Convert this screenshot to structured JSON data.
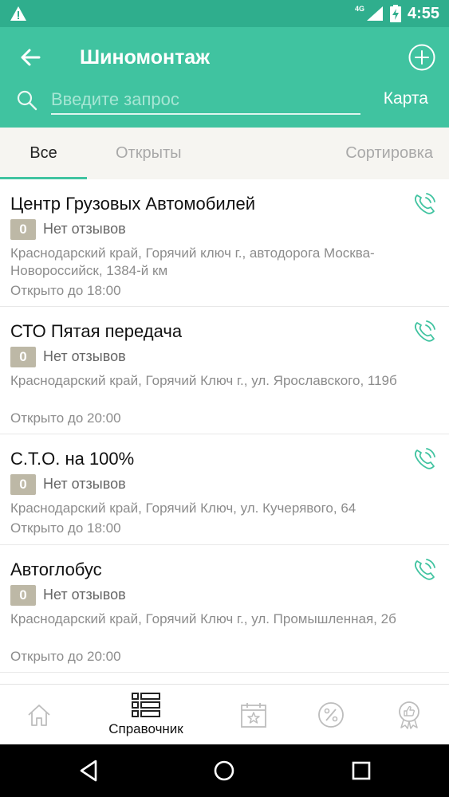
{
  "status_bar": {
    "network": "4G",
    "time": "4:55"
  },
  "app_bar": {
    "title": "Шиномонтаж",
    "search_placeholder": "Введите запрос",
    "map_label": "Карта"
  },
  "tabs": {
    "all": "Все",
    "open": "Открыты",
    "sort": "Сортировка"
  },
  "items": [
    {
      "name": "Центр Грузовых Автомобилей",
      "rating": "0",
      "reviews": "Нет отзывов",
      "address": "Краснодарский край, Горячий ключ г., автодорога Москва-Новороссийск, 1384-й км",
      "hours": "Открыто до 18:00"
    },
    {
      "name": "СТО Пятая передача",
      "rating": "0",
      "reviews": "Нет отзывов",
      "address": "Краснодарский край, Горячий Ключ г., ул. Ярославского, 119б",
      "hours": "Открыто до 20:00"
    },
    {
      "name": "С.Т.О. на 100%",
      "rating": "0",
      "reviews": "Нет отзывов",
      "address": "Краснодарский край, Горячий Ключ, ул. Кучерявого, 64",
      "hours": "Открыто до 18:00"
    },
    {
      "name": "Автоглобус",
      "rating": "0",
      "reviews": "Нет отзывов",
      "address": "Краснодарский край, Горячий Ключ г., ул. Промышленная, 2б",
      "hours": "Открыто до 20:00"
    }
  ],
  "bottom_nav": {
    "directory_label": "Справочник"
  },
  "colors": {
    "primary": "#40c3a0",
    "status_bar": "#2fae8d",
    "badge": "#bdb8a6",
    "icon_gray": "#bdbdbd"
  }
}
